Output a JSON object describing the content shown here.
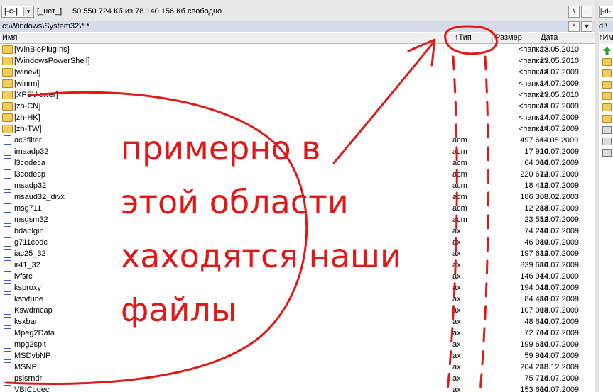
{
  "toolbar": {
    "drive": "[-c-]",
    "drive_arrow": "▼",
    "volume_label": "[_нет_]",
    "free_space": "50 550 724 Кб из 78 140 156 Кб свободно",
    "btn_root": "\\",
    "btn_up": ".."
  },
  "right_panel": {
    "drive": "[-d-",
    "path": "d:\\",
    "header_name": "↑Им"
  },
  "path": {
    "text": "c:\\Windows\\System32\\*.*",
    "btn_star": "*",
    "btn_down": "▼"
  },
  "columns": {
    "name": "Имя",
    "type": "↑Тип",
    "size": "Размер",
    "date": "Дата"
  },
  "files": [
    {
      "name": "[WinBioPlugIns]",
      "ext": "",
      "size": "<папка>",
      "date": "23.05.2010",
      "kind": "folder"
    },
    {
      "name": "[WindowsPowerShell]",
      "ext": "",
      "size": "<папка>",
      "date": "23.05.2010",
      "kind": "folder"
    },
    {
      "name": "[winevt]",
      "ext": "",
      "size": "<папка>",
      "date": "14.07.2009",
      "kind": "folder"
    },
    {
      "name": "[winrm]",
      "ext": "",
      "size": "<папка>",
      "date": "14.07.2009",
      "kind": "folder"
    },
    {
      "name": "[XPSViewer]",
      "ext": "",
      "size": "<папка>",
      "date": "23.05.2010",
      "kind": "folder"
    },
    {
      "name": "[zh-CN]",
      "ext": "",
      "size": "<папка>",
      "date": "14.07.2009",
      "kind": "folder"
    },
    {
      "name": "[zh-HK]",
      "ext": "",
      "size": "<папка>",
      "date": "14.07.2009",
      "kind": "folder"
    },
    {
      "name": "[zh-TW]",
      "ext": "",
      "size": "<папка>",
      "date": "14.07.2009",
      "kind": "folder"
    },
    {
      "name": "ac3filter",
      "ext": "acm",
      "size": "497 664",
      "date": "11.08.2009",
      "kind": "file"
    },
    {
      "name": "imaadp32",
      "ext": "acm",
      "size": "17 920",
      "date": "14.07.2009",
      "kind": "file"
    },
    {
      "name": "l3codeca",
      "ext": "acm",
      "size": "64 000",
      "date": "14.07.2009",
      "kind": "file"
    },
    {
      "name": "l3codecp",
      "ext": "acm",
      "size": "220 672",
      "date": "14.07.2009",
      "kind": "file"
    },
    {
      "name": "msadp32",
      "ext": "acm",
      "size": "18 432",
      "date": "14.07.2009",
      "kind": "file"
    },
    {
      "name": "msaud32_divx",
      "ext": "acm",
      "size": "186 368",
      "date": "03.02.2003",
      "kind": "file"
    },
    {
      "name": "msg711",
      "ext": "acm",
      "size": "12 288",
      "date": "14.07.2009",
      "kind": "file"
    },
    {
      "name": "msgsm32",
      "ext": "acm",
      "size": "23 552",
      "date": "14.07.2009",
      "kind": "file"
    },
    {
      "name": "bdaplgin",
      "ext": "ax",
      "size": "74 240",
      "date": "14.07.2009",
      "kind": "file"
    },
    {
      "name": "g711codc",
      "ext": "ax",
      "size": "46 080",
      "date": "14.07.2009",
      "kind": "file"
    },
    {
      "name": "iac25_32",
      "ext": "ax",
      "size": "197 632",
      "date": "14.07.2009",
      "kind": "file"
    },
    {
      "name": "ir41_32",
      "ext": "ax",
      "size": "839 680",
      "date": "14.07.2009",
      "kind": "file"
    },
    {
      "name": "ivfsrc",
      "ext": "ax",
      "size": "146 944",
      "date": "14.07.2009",
      "kind": "file"
    },
    {
      "name": "ksproxy",
      "ext": "ax",
      "size": "194 048",
      "date": "14.07.2009",
      "kind": "file"
    },
    {
      "name": "kstvtune",
      "ext": "ax",
      "size": "84 480",
      "date": "14.07.2009",
      "kind": "file"
    },
    {
      "name": "Kswdmcap",
      "ext": "ax",
      "size": "107 008",
      "date": "14.07.2009",
      "kind": "file"
    },
    {
      "name": "ksxbar",
      "ext": "ax",
      "size": "48 640",
      "date": "14.07.2009",
      "kind": "file"
    },
    {
      "name": "Mpeg2Data",
      "ext": "ax",
      "size": "72 704",
      "date": "14.07.2009",
      "kind": "file"
    },
    {
      "name": "mpg2splt",
      "ext": "ax",
      "size": "199 680",
      "date": "14.07.2009",
      "kind": "file"
    },
    {
      "name": "MSDvbNP",
      "ext": "ax",
      "size": "59 904",
      "date": "14.07.2009",
      "kind": "file"
    },
    {
      "name": "MSNP",
      "ext": "ax",
      "size": "204 288",
      "date": "13.12.2009",
      "kind": "file"
    },
    {
      "name": "psisrndr",
      "ext": "ax",
      "size": "75 776",
      "date": "14.07.2009",
      "kind": "file"
    },
    {
      "name": "VBICodec",
      "ext": "ax",
      "size": "153 600",
      "date": "14.07.2009",
      "kind": "file"
    }
  ],
  "annotation": {
    "color": "#e01818",
    "lines": [
      "примерно в",
      "этой области",
      "хаходятся наши",
      "файлы"
    ]
  }
}
